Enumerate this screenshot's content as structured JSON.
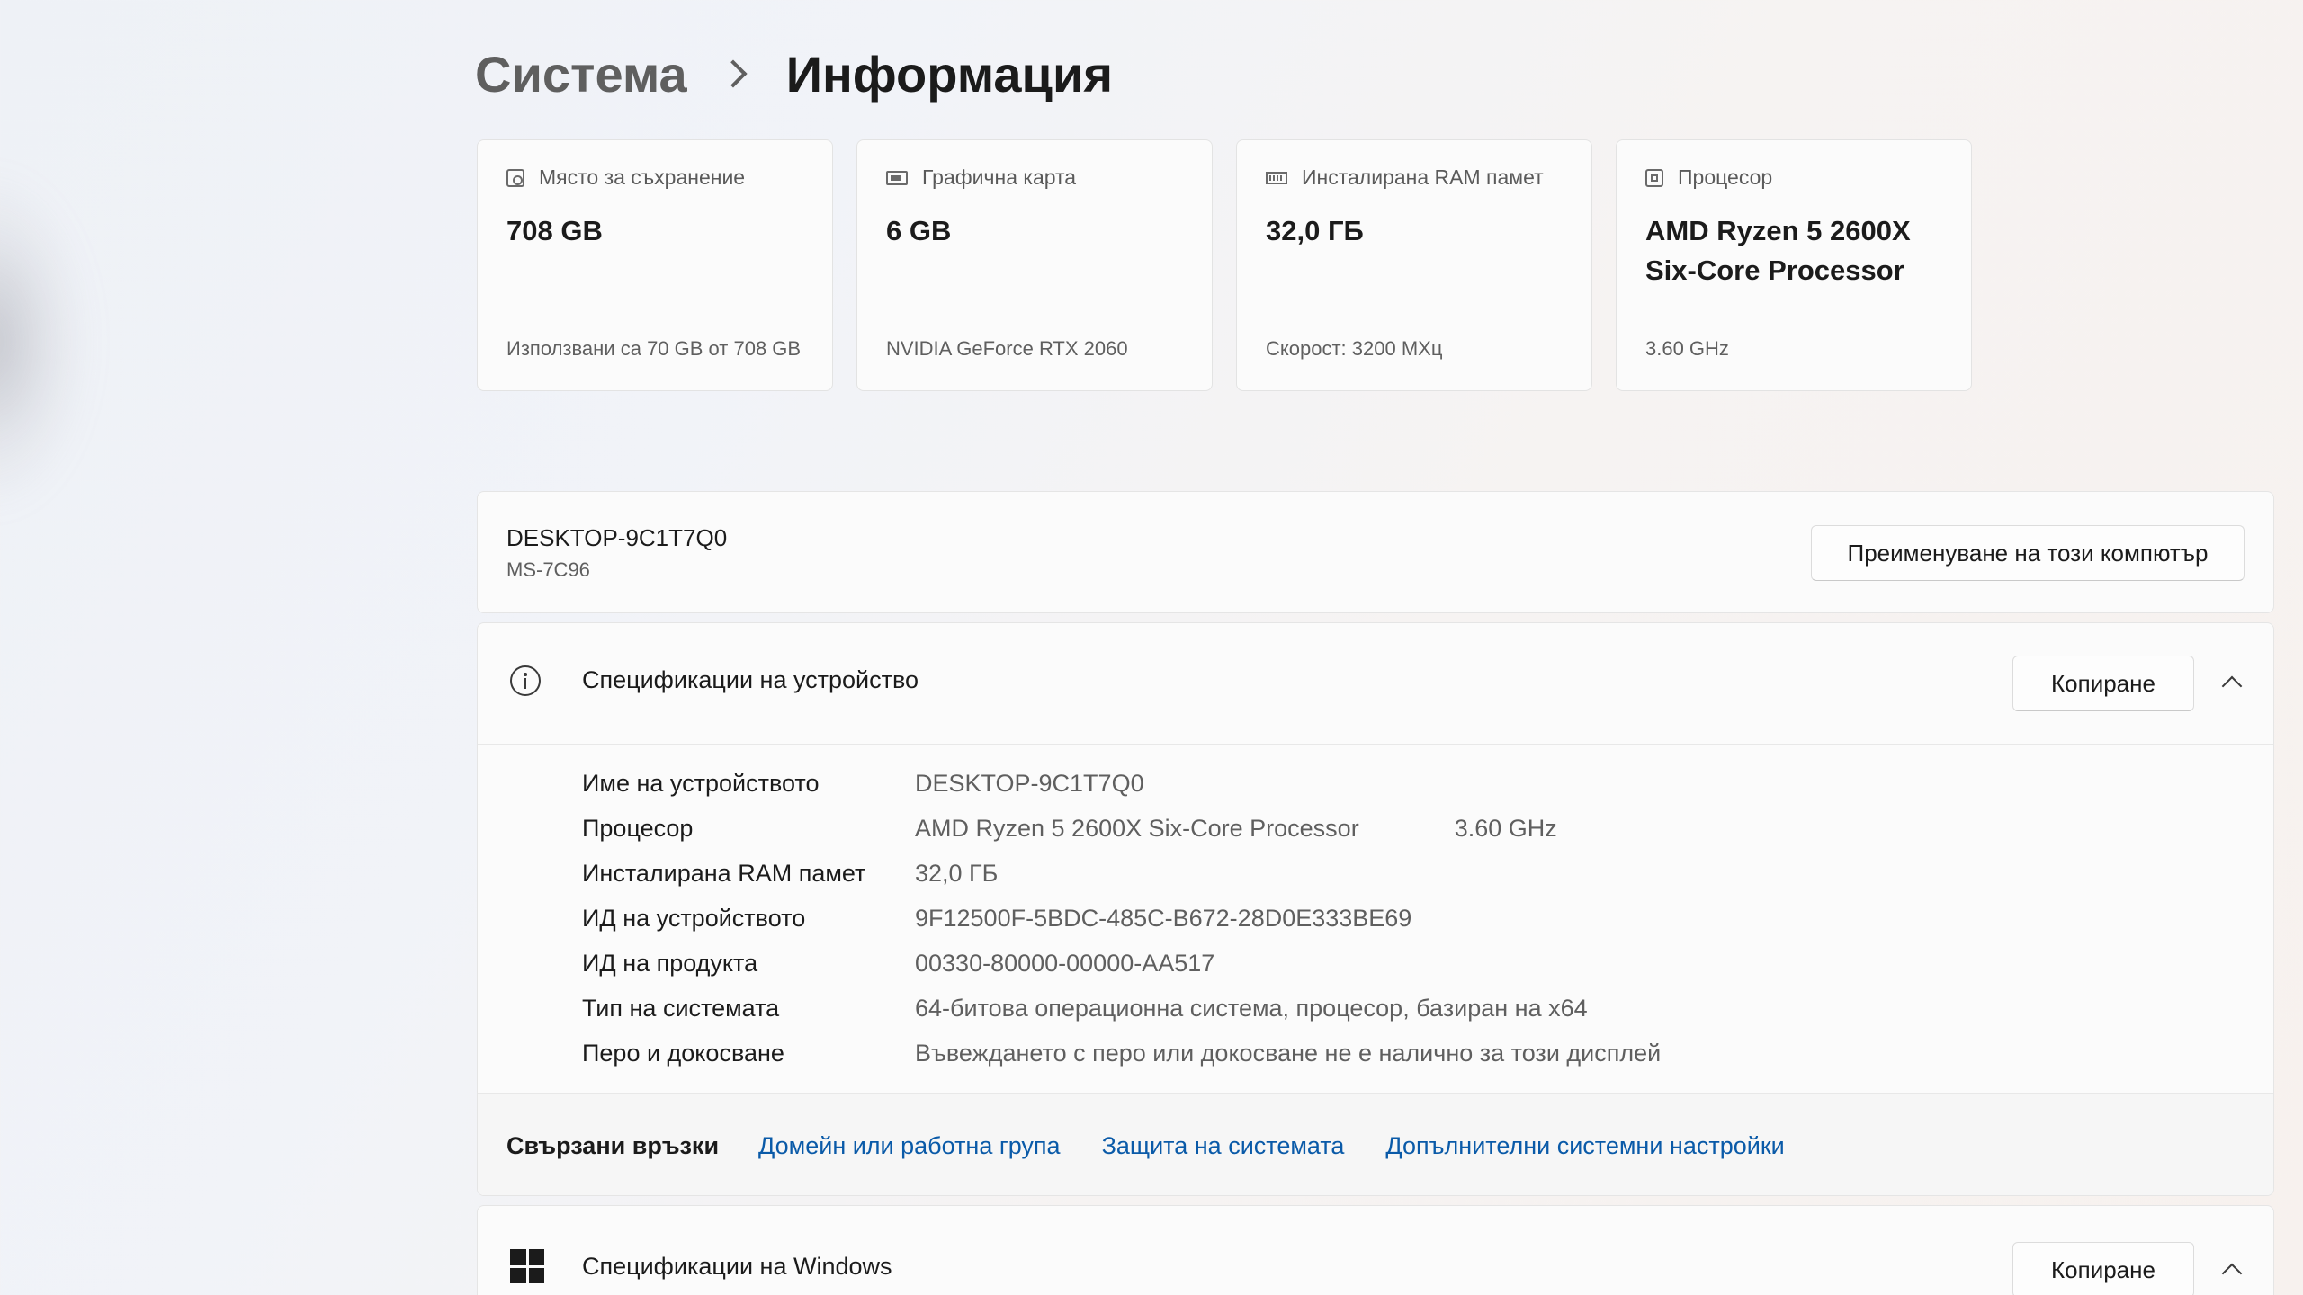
{
  "breadcrumb": {
    "parent": "Система",
    "current": "Информация"
  },
  "cards": [
    {
      "icon": "storage-icon",
      "title": "Място за съхранение",
      "value": "708 GB",
      "sub": "Използвани са 70 GB от 708 GB"
    },
    {
      "icon": "graphics-card-icon",
      "title": "Графична карта",
      "value": "6 GB",
      "sub": "NVIDIA GeForce RTX 2060"
    },
    {
      "icon": "ram-icon",
      "title": "Инсталирана RAM памет",
      "value": "32,0 ГБ",
      "sub": "Скорост: 3200 MХц"
    },
    {
      "icon": "processor-icon",
      "title": "Процесор",
      "value": "AMD Ryzen 5 2600X Six-Core Processor",
      "sub": "3.60 GHz"
    }
  ],
  "device": {
    "name": "DESKTOP-9C1T7Q0",
    "model": "MS-7C96",
    "rename_label": "Преименуване на този компютър"
  },
  "device_specs": {
    "title": "Спецификации на устройство",
    "copy_label": "Копиране",
    "rows": [
      {
        "label": "Име на устройството",
        "value": "DESKTOP-9C1T7Q0",
        "extra": ""
      },
      {
        "label": "Процесор",
        "value": "AMD Ryzen 5 2600X Six-Core Processor",
        "extra": "3.60 GHz"
      },
      {
        "label": "Инсталирана RAM памет",
        "value": "32,0 ГБ",
        "extra": ""
      },
      {
        "label": "ИД на устройството",
        "value": "9F12500F-5BDC-485C-B672-28D0E333BE69",
        "extra": ""
      },
      {
        "label": "ИД на продукта",
        "value": "00330-80000-00000-AA517",
        "extra": ""
      },
      {
        "label": "Тип на системата",
        "value": "64-битова операционна система, процесор, базиран на x64",
        "extra": ""
      },
      {
        "label": "Перо и докосване",
        "value": "Въвеждането с перо или докосване не е налично за този дисплей",
        "extra": ""
      }
    ],
    "related": {
      "title": "Свързани връзки",
      "links": [
        "Домейн или работна група",
        "Защита на системата",
        "Допълнителни системни настройки"
      ]
    }
  },
  "windows_specs": {
    "title": "Спецификации на Windows",
    "copy_label": "Копиране"
  },
  "colors": {
    "link": "#0a5aa8",
    "text_primary": "#1b1b1b",
    "text_secondary": "#5f5f5f"
  }
}
